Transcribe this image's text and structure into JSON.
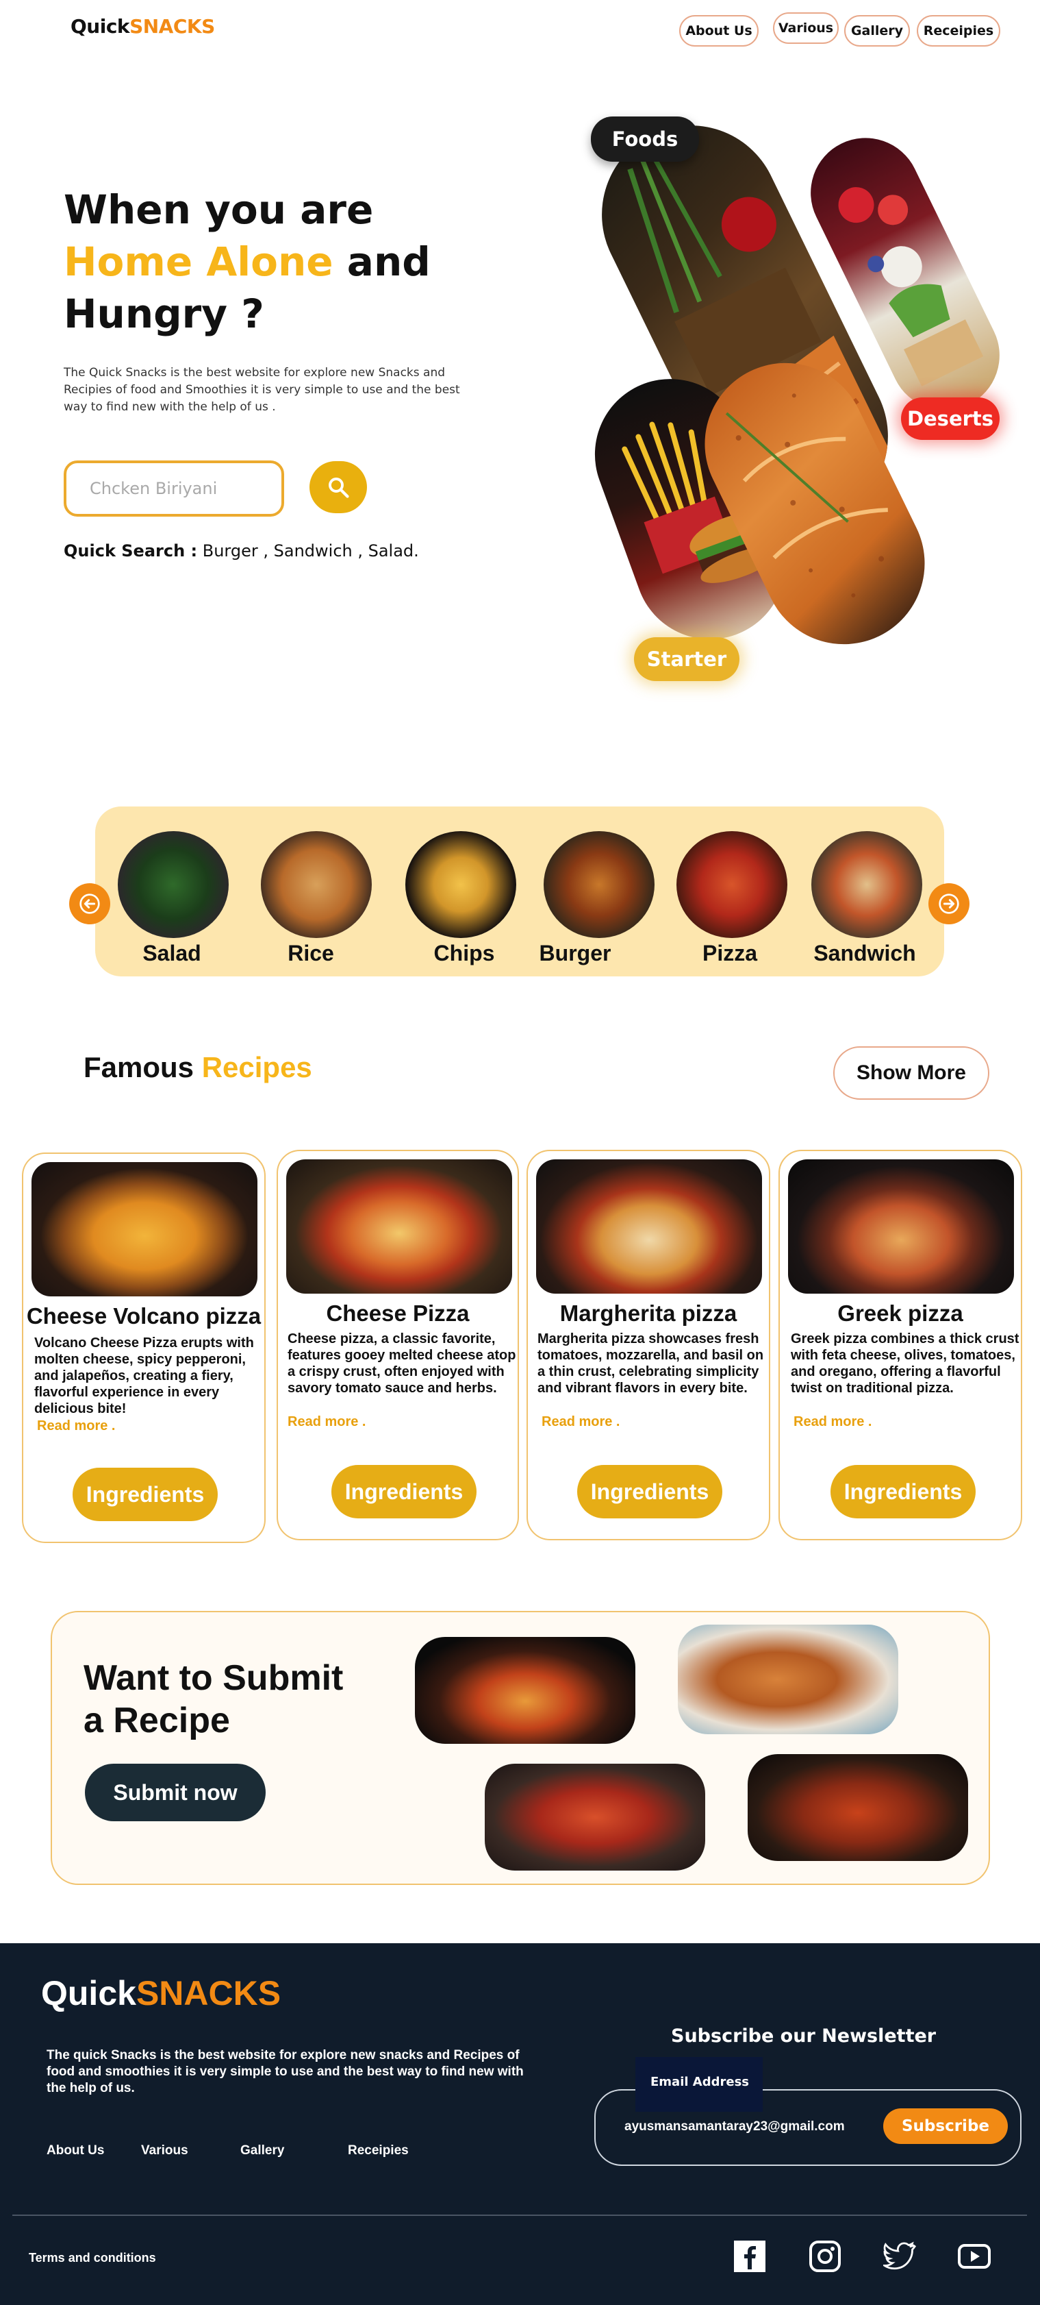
{
  "brand": {
    "part1": "Quick",
    "part2": "SNACKS"
  },
  "nav": {
    "about": "About Us",
    "various": "Various",
    "gallery": "Gallery",
    "recipes": "Receipies"
  },
  "hero": {
    "title_line1": "When you are",
    "title_highlight": "Home Alone",
    "title_and": " and",
    "title_line3": "Hungry ?",
    "description": "The Quick Snacks is the best website for explore new Snacks and Recipies of food and Smoothies it is very simple to use and the best way to find new with the help of us .",
    "search_placeholder": "Chcken Biriyani",
    "quick_search_label": "Quick Search :",
    "quick_search_items": " Burger , Sandwich , Salad.",
    "tags": {
      "foods": "Foods",
      "deserts": "Deserts",
      "starter": "Starter"
    }
  },
  "categories": {
    "items": [
      {
        "label": "Salad"
      },
      {
        "label": "Rice"
      },
      {
        "label": "Chips"
      },
      {
        "label": "Burger"
      },
      {
        "label": "Pizza"
      },
      {
        "label": "Sandwich"
      }
    ]
  },
  "famous": {
    "title_part1": "Famous ",
    "title_part2": "Recipes",
    "show_more": "Show More",
    "cards": [
      {
        "title": "Cheese Volcano pizza",
        "desc": "Volcano Cheese Pizza erupts with molten cheese, spicy pepperoni, and jalapeños, creating a fiery, flavorful experience in every delicious bite!",
        "more": "Read more .",
        "button": "Ingredients"
      },
      {
        "title": "Cheese Pizza",
        "desc": "Cheese pizza, a classic favorite, features gooey melted cheese atop a crispy crust, often enjoyed with savory tomato sauce and herbs.",
        "more": "Read more .",
        "button": "Ingredients"
      },
      {
        "title": "Margherita pizza",
        "desc": "Margherita pizza showcases fresh tomatoes, mozzarella, and basil on a thin crust, celebrating simplicity and vibrant flavors in every bite.",
        "more": "Read more .",
        "button": "Ingredients"
      },
      {
        "title": "Greek pizza",
        "desc": "Greek pizza combines a thick crust with feta cheese, olives, tomatoes, and oregano, offering a flavorful twist on traditional pizza.",
        "more": "Read more .",
        "button": "Ingredients"
      }
    ]
  },
  "submit": {
    "title_line1": "Want to Submit",
    "title_line2": "a Recipe",
    "button": "Submit now"
  },
  "footer": {
    "description": "The quick Snacks is the best website for explore new snacks and Recipes of food and smoothies it is very simple to use and the best way to find new with the help of us.",
    "links": {
      "about": "About Us",
      "various": "Various",
      "gallery": "Gallery",
      "recipes": "Receipies"
    },
    "newsletter_title": "Subscribe our Newsletter",
    "email_label": "Email Address",
    "email_value": "ayusmansamantaray23@gmail.com",
    "subscribe": "Subscribe",
    "terms": "Terms and conditions",
    "social": [
      "facebook-icon",
      "instagram-icon",
      "twitter-icon",
      "youtube-icon"
    ]
  },
  "colors": {
    "accent": "#f7b51a",
    "orange": "#f28a14",
    "footer_bg": "#101c2b",
    "button_gold": "#e6ad16"
  }
}
